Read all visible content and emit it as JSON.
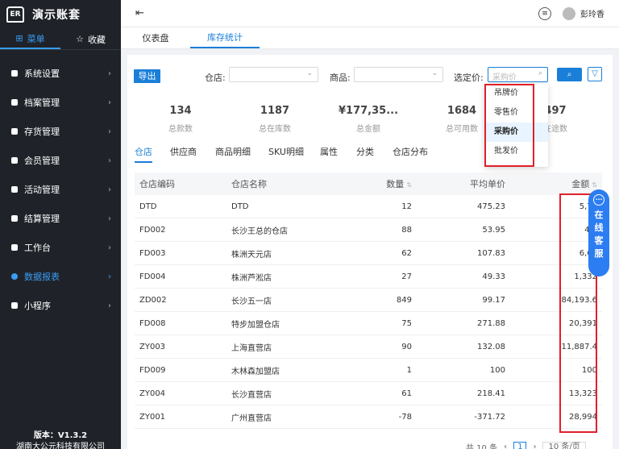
{
  "app": {
    "logo_text": "演示账套",
    "logo_mark": "ER"
  },
  "sidebar": {
    "tabs": [
      {
        "label": "菜单"
      },
      {
        "label": "收藏"
      }
    ],
    "items": [
      {
        "label": "系统设置"
      },
      {
        "label": "档案管理"
      },
      {
        "label": "存货管理"
      },
      {
        "label": "会员管理"
      },
      {
        "label": "活动管理"
      },
      {
        "label": "结算管理"
      },
      {
        "label": "工作台"
      },
      {
        "label": "数据报表"
      },
      {
        "label": "小程序"
      }
    ],
    "version": "版本：V1.3.2",
    "company": "湖南大公元科技有限公司"
  },
  "topbar": {
    "user": "彭玲香"
  },
  "page_tabs": [
    {
      "label": "仪表盘"
    },
    {
      "label": "库存统计"
    }
  ],
  "filters": {
    "export_label": "导出",
    "warehouse_label": "仓店:",
    "product_label": "商品:",
    "price_label": "选定价:",
    "price_placeholder": "采购价"
  },
  "price_options": [
    "吊牌价",
    "零售价",
    "采购价",
    "批发价"
  ],
  "stats": [
    {
      "value": "134",
      "label": "总款数"
    },
    {
      "value": "1187",
      "label": "总在库数"
    },
    {
      "value": "¥177,35...",
      "label": "总金额"
    },
    {
      "value": "1684",
      "label": "总可用数"
    },
    {
      "value": "497",
      "label": "在途数"
    }
  ],
  "subtabs": [
    "仓店",
    "供应商",
    "商品明细",
    "SKU明细",
    "属性",
    "分类",
    "仓店分布"
  ],
  "table": {
    "headers": [
      "仓店编码",
      "仓店名称",
      "数量",
      "平均单价",
      "金额"
    ],
    "rows": [
      {
        "code": "DTD",
        "name": "DTD",
        "qty": "12",
        "price": "475.23",
        "amount": "5,70"
      },
      {
        "code": "FD002",
        "name": "长沙王总的仓店",
        "qty": "88",
        "price": "53.95",
        "amount": "4,7"
      },
      {
        "code": "FD003",
        "name": "株洲天元店",
        "qty": "62",
        "price": "107.83",
        "amount": "6,68"
      },
      {
        "code": "FD004",
        "name": "株洲芦淞店",
        "qty": "27",
        "price": "49.33",
        "amount": "1,332"
      },
      {
        "code": "ZD002",
        "name": "长沙五一店",
        "qty": "849",
        "price": "99.17",
        "amount": "84,193.6"
      },
      {
        "code": "FD008",
        "name": "特步加盟仓店",
        "qty": "75",
        "price": "271.88",
        "amount": "20,391"
      },
      {
        "code": "ZY003",
        "name": "上海直营店",
        "qty": "90",
        "price": "132.08",
        "amount": "11,887.4"
      },
      {
        "code": "FD009",
        "name": "木林森加盟店",
        "qty": "1",
        "price": "100",
        "amount": "100"
      },
      {
        "code": "ZY004",
        "name": "长沙直营店",
        "qty": "61",
        "price": "218.41",
        "amount": "13,323"
      },
      {
        "code": "ZY001",
        "name": "广州直营店",
        "qty": "-78",
        "price": "-371.72",
        "amount": "28,994"
      }
    ]
  },
  "pager": {
    "total": "共 10 条",
    "page": "1",
    "size": "10 条/页"
  },
  "chat": {
    "label_chars": [
      "在",
      "线",
      "客",
      "服"
    ]
  }
}
